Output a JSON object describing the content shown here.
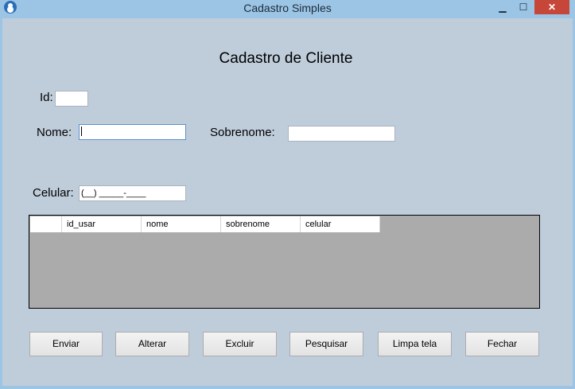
{
  "window": {
    "title": "Cadastro Simples",
    "minimize": "▁",
    "maximize": "☐",
    "close": "✕"
  },
  "form": {
    "title": "Cadastro de Cliente",
    "id_label": "Id:",
    "id_value": "",
    "nome_label": "Nome:",
    "nome_value": "",
    "sobrenome_label": "Sobrenome:",
    "sobrenome_value": "",
    "celular_label": "Celular:",
    "celular_value": "(__) _____-____"
  },
  "grid": {
    "columns": [
      "id_usar",
      "nome",
      "sobrenome",
      "celular"
    ]
  },
  "buttons": {
    "enviar": "Enviar",
    "alterar": "Alterar",
    "excluir": "Excluir",
    "pesquisar": "Pesquisar",
    "limpa": "Limpa tela",
    "fechar": "Fechar"
  },
  "colors": {
    "client_bg": "#bfcddb",
    "frame": "#9cc4e4",
    "close": "#c7463a",
    "grid_bg": "#ababab"
  }
}
